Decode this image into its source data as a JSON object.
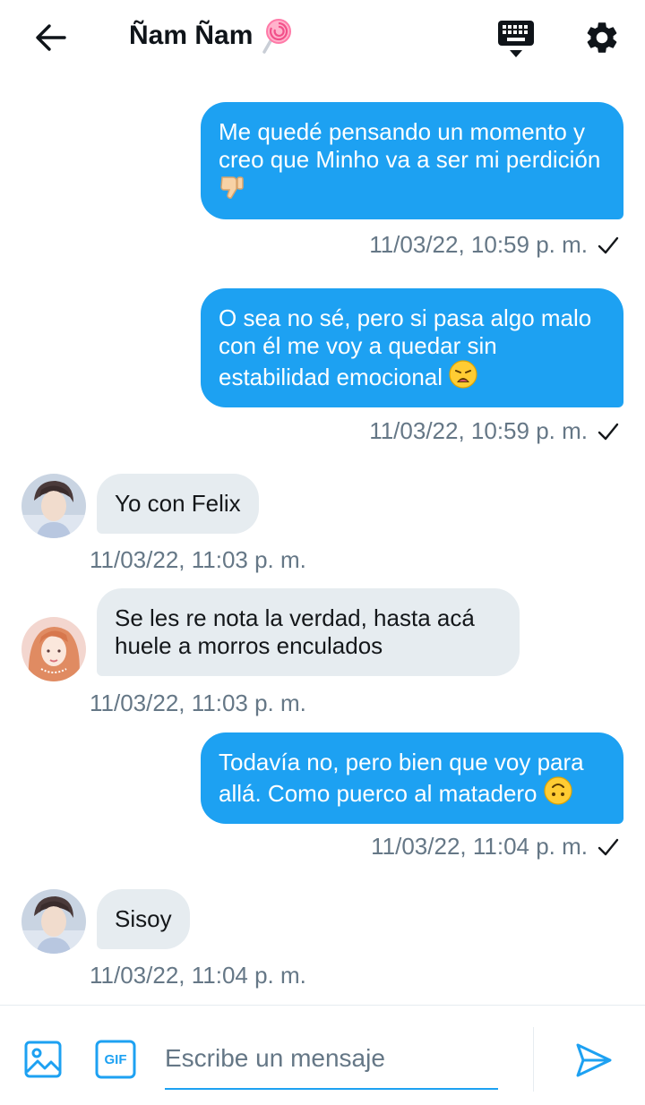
{
  "header": {
    "title": "Ñam Ñam",
    "title_emoji": "lollipop-icon",
    "back_icon": "arrow-left-icon",
    "keyboard_icon": "keyboard-icon",
    "settings_icon": "gear-icon"
  },
  "messages": [
    {
      "direction": "out",
      "text": "Me quedé pensando un momento y creo que Minho va a ser mi perdición",
      "emoji": "thumbs-down-icon",
      "timestamp": "11/03/22, 10:59 p. m.",
      "status": "sent"
    },
    {
      "direction": "out",
      "text": "O sea no sé, pero si pasa algo malo con él me voy a quedar sin estabilidad emocional",
      "emoji": "weary-face-icon",
      "timestamp": "11/03/22, 10:59 p. m.",
      "status": "sent"
    },
    {
      "direction": "in",
      "text": "Yo con Felix",
      "avatar": "avatar-boy",
      "timestamp": "11/03/22, 11:03 p. m."
    },
    {
      "direction": "in",
      "text": "Se les re nota la verdad, hasta acá huele a morros enculados",
      "avatar": "avatar-girl",
      "timestamp": "11/03/22, 11:03 p. m."
    },
    {
      "direction": "out",
      "text": "Todavía no, pero bien que voy para allá. Como puerco al matadero",
      "emoji": "upside-down-face-icon",
      "timestamp": "11/03/22, 11:04 p. m.",
      "status": "sent"
    },
    {
      "direction": "in",
      "text": "Sisoy",
      "avatar": "avatar-boy",
      "timestamp": "11/03/22, 11:04 p. m."
    }
  ],
  "composer": {
    "placeholder": "Escribe un mensaje",
    "value": "",
    "gif_label": "GIF"
  },
  "colors": {
    "accent": "#1da1f2",
    "incoming_bubble": "#e6ecf0",
    "timestamp": "#657786"
  }
}
